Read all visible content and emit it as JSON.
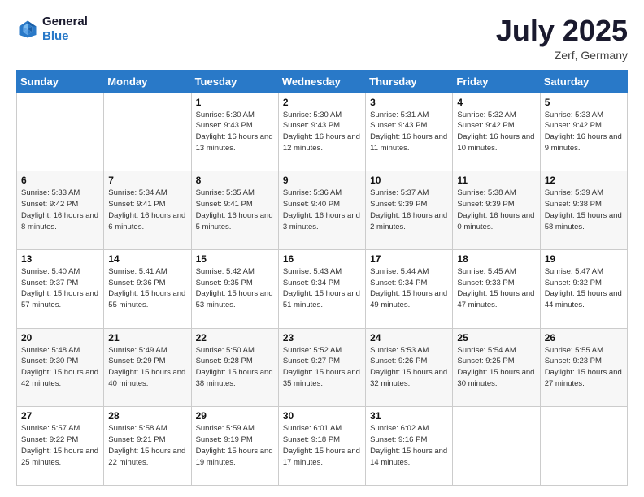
{
  "header": {
    "logo_line1": "General",
    "logo_line2": "Blue",
    "month": "July 2025",
    "location": "Zerf, Germany"
  },
  "days_of_week": [
    "Sunday",
    "Monday",
    "Tuesday",
    "Wednesday",
    "Thursday",
    "Friday",
    "Saturday"
  ],
  "weeks": [
    [
      {
        "day": "",
        "info": ""
      },
      {
        "day": "",
        "info": ""
      },
      {
        "day": "1",
        "info": "Sunrise: 5:30 AM\nSunset: 9:43 PM\nDaylight: 16 hours and 13 minutes."
      },
      {
        "day": "2",
        "info": "Sunrise: 5:30 AM\nSunset: 9:43 PM\nDaylight: 16 hours and 12 minutes."
      },
      {
        "day": "3",
        "info": "Sunrise: 5:31 AM\nSunset: 9:43 PM\nDaylight: 16 hours and 11 minutes."
      },
      {
        "day": "4",
        "info": "Sunrise: 5:32 AM\nSunset: 9:42 PM\nDaylight: 16 hours and 10 minutes."
      },
      {
        "day": "5",
        "info": "Sunrise: 5:33 AM\nSunset: 9:42 PM\nDaylight: 16 hours and 9 minutes."
      }
    ],
    [
      {
        "day": "6",
        "info": "Sunrise: 5:33 AM\nSunset: 9:42 PM\nDaylight: 16 hours and 8 minutes."
      },
      {
        "day": "7",
        "info": "Sunrise: 5:34 AM\nSunset: 9:41 PM\nDaylight: 16 hours and 6 minutes."
      },
      {
        "day": "8",
        "info": "Sunrise: 5:35 AM\nSunset: 9:41 PM\nDaylight: 16 hours and 5 minutes."
      },
      {
        "day": "9",
        "info": "Sunrise: 5:36 AM\nSunset: 9:40 PM\nDaylight: 16 hours and 3 minutes."
      },
      {
        "day": "10",
        "info": "Sunrise: 5:37 AM\nSunset: 9:39 PM\nDaylight: 16 hours and 2 minutes."
      },
      {
        "day": "11",
        "info": "Sunrise: 5:38 AM\nSunset: 9:39 PM\nDaylight: 16 hours and 0 minutes."
      },
      {
        "day": "12",
        "info": "Sunrise: 5:39 AM\nSunset: 9:38 PM\nDaylight: 15 hours and 58 minutes."
      }
    ],
    [
      {
        "day": "13",
        "info": "Sunrise: 5:40 AM\nSunset: 9:37 PM\nDaylight: 15 hours and 57 minutes."
      },
      {
        "day": "14",
        "info": "Sunrise: 5:41 AM\nSunset: 9:36 PM\nDaylight: 15 hours and 55 minutes."
      },
      {
        "day": "15",
        "info": "Sunrise: 5:42 AM\nSunset: 9:35 PM\nDaylight: 15 hours and 53 minutes."
      },
      {
        "day": "16",
        "info": "Sunrise: 5:43 AM\nSunset: 9:34 PM\nDaylight: 15 hours and 51 minutes."
      },
      {
        "day": "17",
        "info": "Sunrise: 5:44 AM\nSunset: 9:34 PM\nDaylight: 15 hours and 49 minutes."
      },
      {
        "day": "18",
        "info": "Sunrise: 5:45 AM\nSunset: 9:33 PM\nDaylight: 15 hours and 47 minutes."
      },
      {
        "day": "19",
        "info": "Sunrise: 5:47 AM\nSunset: 9:32 PM\nDaylight: 15 hours and 44 minutes."
      }
    ],
    [
      {
        "day": "20",
        "info": "Sunrise: 5:48 AM\nSunset: 9:30 PM\nDaylight: 15 hours and 42 minutes."
      },
      {
        "day": "21",
        "info": "Sunrise: 5:49 AM\nSunset: 9:29 PM\nDaylight: 15 hours and 40 minutes."
      },
      {
        "day": "22",
        "info": "Sunrise: 5:50 AM\nSunset: 9:28 PM\nDaylight: 15 hours and 38 minutes."
      },
      {
        "day": "23",
        "info": "Sunrise: 5:52 AM\nSunset: 9:27 PM\nDaylight: 15 hours and 35 minutes."
      },
      {
        "day": "24",
        "info": "Sunrise: 5:53 AM\nSunset: 9:26 PM\nDaylight: 15 hours and 32 minutes."
      },
      {
        "day": "25",
        "info": "Sunrise: 5:54 AM\nSunset: 9:25 PM\nDaylight: 15 hours and 30 minutes."
      },
      {
        "day": "26",
        "info": "Sunrise: 5:55 AM\nSunset: 9:23 PM\nDaylight: 15 hours and 27 minutes."
      }
    ],
    [
      {
        "day": "27",
        "info": "Sunrise: 5:57 AM\nSunset: 9:22 PM\nDaylight: 15 hours and 25 minutes."
      },
      {
        "day": "28",
        "info": "Sunrise: 5:58 AM\nSunset: 9:21 PM\nDaylight: 15 hours and 22 minutes."
      },
      {
        "day": "29",
        "info": "Sunrise: 5:59 AM\nSunset: 9:19 PM\nDaylight: 15 hours and 19 minutes."
      },
      {
        "day": "30",
        "info": "Sunrise: 6:01 AM\nSunset: 9:18 PM\nDaylight: 15 hours and 17 minutes."
      },
      {
        "day": "31",
        "info": "Sunrise: 6:02 AM\nSunset: 9:16 PM\nDaylight: 15 hours and 14 minutes."
      },
      {
        "day": "",
        "info": ""
      },
      {
        "day": "",
        "info": ""
      }
    ]
  ]
}
